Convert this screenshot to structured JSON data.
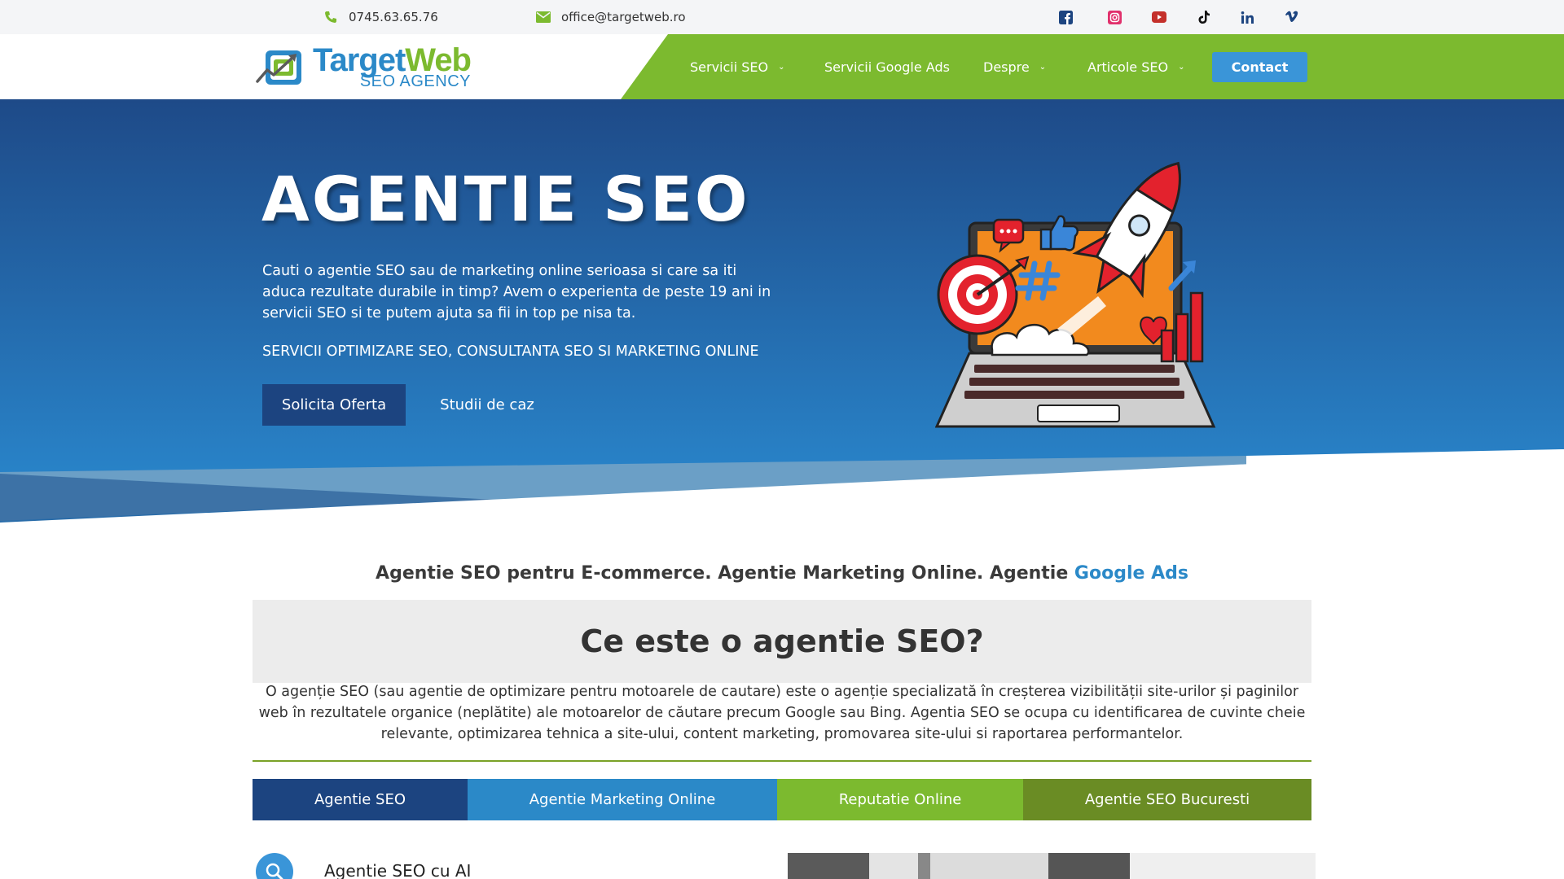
{
  "topbar": {
    "phone": "0745.63.65.76",
    "email": "office@targetweb.ro",
    "socials": [
      {
        "name": "facebook-icon",
        "color": "#1c4480"
      },
      {
        "name": "instagram-icon",
        "color": "#e1306c"
      },
      {
        "name": "youtube-icon",
        "color": "#c4302b"
      },
      {
        "name": "tiktok-icon",
        "color": "#111111"
      },
      {
        "name": "linkedin-icon",
        "color": "#1c4480"
      },
      {
        "name": "vimeo-icon",
        "color": "#1c4480"
      }
    ]
  },
  "header": {
    "logo_main_1": "Target",
    "logo_main_2": "Web",
    "logo_sub": "SEO AGENCY",
    "nav": [
      {
        "label": "Servicii SEO",
        "dropdown": true
      },
      {
        "label": "Servicii Google Ads",
        "dropdown": false
      },
      {
        "label": "Despre",
        "dropdown": true
      },
      {
        "label": "Articole SEO",
        "dropdown": true
      }
    ],
    "contact_label": "Contact"
  },
  "hero": {
    "title": "AGENTIE SEO",
    "description": "Cauti o agentie SEO sau de marketing online serioasa si care sa iti aduca rezultate durabile in timp? Avem o experienta de peste 19 ani in servicii SEO si te putem ajuta sa fii in top pe nisa ta.",
    "services": "SERVICII OPTIMIZARE SEO, CONSULTANTA SEO SI MARKETING ONLINE",
    "btn_primary": "Solicita Oferta",
    "btn_secondary": "Studii de caz"
  },
  "content": {
    "subtitle_main": "Agentie SEO pentru E-commerce. Agentie Marketing Online. Agentie ",
    "subtitle_link": "Google Ads",
    "section_title": "Ce este o agentie SEO?",
    "paragraph": "O agenție SEO (sau agentie de optimizare pentru motoarele de cautare) este o agenție specializată în creșterea vizibilității site-urilor și paginilor web în rezultatele organice (neplătite) ale motoarelor de căutare precum Google sau Bing. Agentia SEO se ocupa cu identificarea de cuvinte cheie relevante, optimizarea tehnica a site-ului, content marketing, promovarea site-ului si raportarea performantelor.",
    "tabs": [
      {
        "label": "Agentie SEO",
        "color": "#1c4480"
      },
      {
        "label": "Agentie Marketing Online",
        "color": "#2b89c8"
      },
      {
        "label": "Reputatie Online",
        "color": "#7cba2f"
      },
      {
        "label": "Agentie SEO Bucuresti",
        "color": "#6a8c24"
      }
    ],
    "feature_title": "Agentie SEO cu AI"
  },
  "colors": {
    "green": "#7cba2f",
    "blue_dark": "#1c4480",
    "blue": "#2b89c8"
  }
}
